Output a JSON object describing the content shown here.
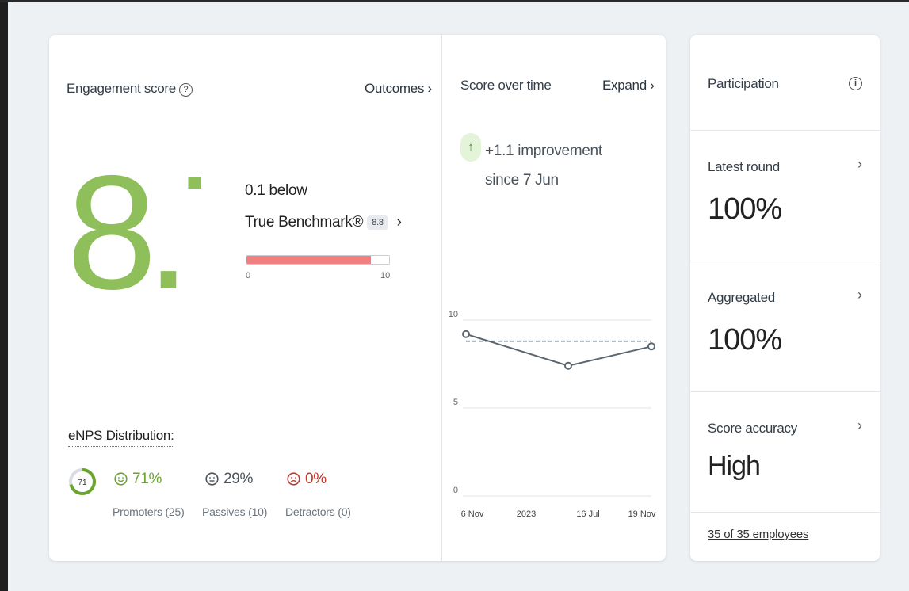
{
  "engagement": {
    "title": "Engagement score",
    "help_glyph": "?",
    "outcomes_link": "Outcomes ›",
    "score": "8.7",
    "below_text": "0.1 below",
    "benchmark_label": "True Benchmark®",
    "benchmark_value": "8.8",
    "benchmark_chevron": "›",
    "bar": {
      "min_label": "0",
      "max_label": "10",
      "score_fraction": 0.87,
      "benchmark_fraction": 0.88
    }
  },
  "enps": {
    "title": "eNPS Distribution:",
    "score": "71",
    "promoters": {
      "pct": "71%",
      "label": "Promoters (25)",
      "fraction": 0.71
    },
    "passives": {
      "pct": "29%",
      "label": "Passives (10)",
      "fraction": 0.29
    },
    "detractors": {
      "pct": "0%",
      "label": "Detractors (0)",
      "fraction": 0.0
    }
  },
  "score_over_time": {
    "title": "Score over time",
    "expand_link": "Expand ›",
    "improvement_arrow": "↑",
    "improvement_line1": "+1.1 improvement",
    "improvement_line2": "since 7 Jun"
  },
  "chart_data": {
    "type": "line",
    "x": [
      "6 Nov",
      "16 Jul",
      "19 Nov"
    ],
    "x_tick_labels": [
      "6 Nov",
      "2023",
      "16 Jul",
      "19 Nov"
    ],
    "series": [
      {
        "values": [
          9.2,
          7.4,
          8.5
        ]
      }
    ],
    "benchmark": 8.8,
    "ylim": [
      0,
      10
    ],
    "y_ticks": [
      "10",
      "5",
      "0"
    ],
    "grid": true
  },
  "participation": {
    "title": "Participation",
    "info_glyph": "i",
    "rows": [
      {
        "label": "Latest round",
        "value": "100%"
      },
      {
        "label": "Aggregated",
        "value": "100%"
      },
      {
        "label": "Score accuracy",
        "value": "High"
      }
    ],
    "chevron": "›",
    "employees_link": "35 of 35 employees"
  },
  "colors": {
    "accent_green": "#6aa52e",
    "light_green": "#8fbf5a",
    "bar_red": "#f08080",
    "detractor_red": "#c0392b",
    "line_gray": "#5b6770"
  }
}
